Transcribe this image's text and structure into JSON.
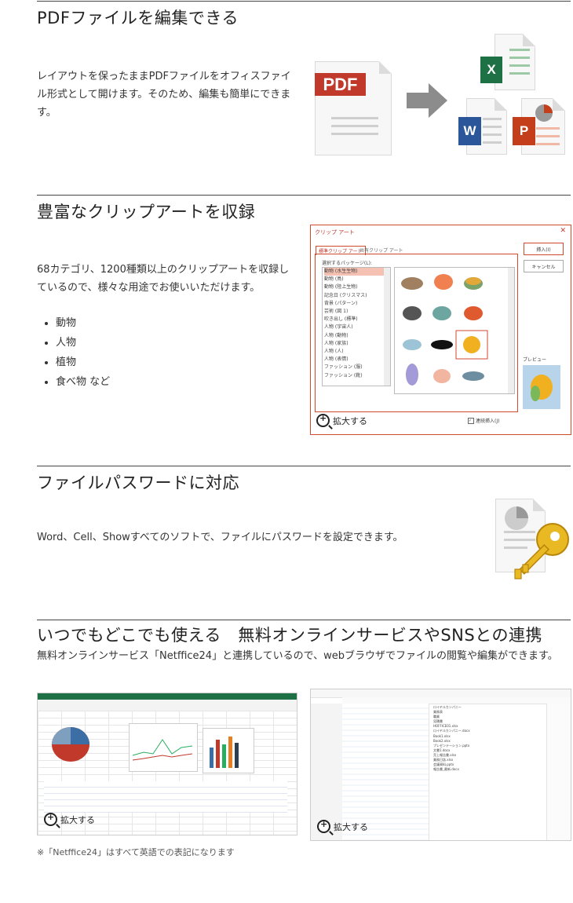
{
  "sections": [
    {
      "title": "PDFファイルを編集できる",
      "body": "レイアウトを保ったままPDFファイルをオフィスファイル形式として開けます。そのため、編集も簡単にできます。",
      "pdf_label": "PDF",
      "excel_label": "X",
      "word_label": "W",
      "ppt_label": "P"
    },
    {
      "title": "豊富なクリップアートを収録",
      "body": "68カテゴリ、1200種類以上のクリップアートを収録しているので、様々な用途でお使いいただけます。",
      "bullets": [
        "動物",
        "人物",
        "植物",
        "食べ物 など"
      ],
      "dialog": {
        "title": "クリップ アート",
        "tab_active": "標準クリップ アート",
        "tab_inactive": "共有クリップ アート",
        "select_label": "選択するパッケージ(L):",
        "categories": [
          "動物 (水生生物)",
          "動物 (鳥)",
          "動物 (陸上生物)",
          "記念日 (クリスマス)",
          "背景 (パターン)",
          "芸術 (図 1)",
          "吹き出し (標準)",
          "人物 (宇宙人)",
          "人物 (動物)",
          "人物 (家族)",
          "人物 (人)",
          "人物 (表情)",
          "ファッション (服)",
          "ファッション (靴)"
        ],
        "insert_button": "挿入(I)",
        "cancel_button": "キャンセル",
        "preview_label": "プレビュー",
        "checkbox_label": "連続挿入(J)",
        "close": "✕"
      },
      "zoom_label": "拡大する"
    },
    {
      "title": "ファイルパスワードに対応",
      "body": "Word、Cell、Showすべてのソフトで、ファイルにパスワードを設定できます。"
    },
    {
      "title": "いつでもどこでも使える　無料オンラインサービスやSNSとの連携",
      "body": "無料オンラインサービス「Netffice24」と連携しているので、webブラウザでファイルの閲覧や編集ができます。",
      "zoom_label_1": "拡大する",
      "zoom_label_2": "拡大する",
      "note": "※「Netffice24」はすべて英語での表記になります",
      "file_list": [
        "ロイヤルカンパニー",
        "業務表",
        "職業",
        "見積書",
        "HOFFICE01.xlsx",
        "ロイヤルカンパニー.docx",
        "Book1.xlsx",
        "Book2.xlsx",
        "プレゼンテーション.pptx",
        "文書1.docx",
        "売上報告書.xlsx",
        "業務日誌.xlsx",
        "会議資料.pptx",
        "報告書_最新.docx"
      ]
    }
  ],
  "colors": {
    "pdf_red": "#c0392b",
    "excel_green": "#1e7145",
    "word_blue": "#2b579a",
    "ppt_orange": "#c43e1c",
    "dialog_border": "#d24a2c",
    "key_gold": "#e8b923"
  }
}
